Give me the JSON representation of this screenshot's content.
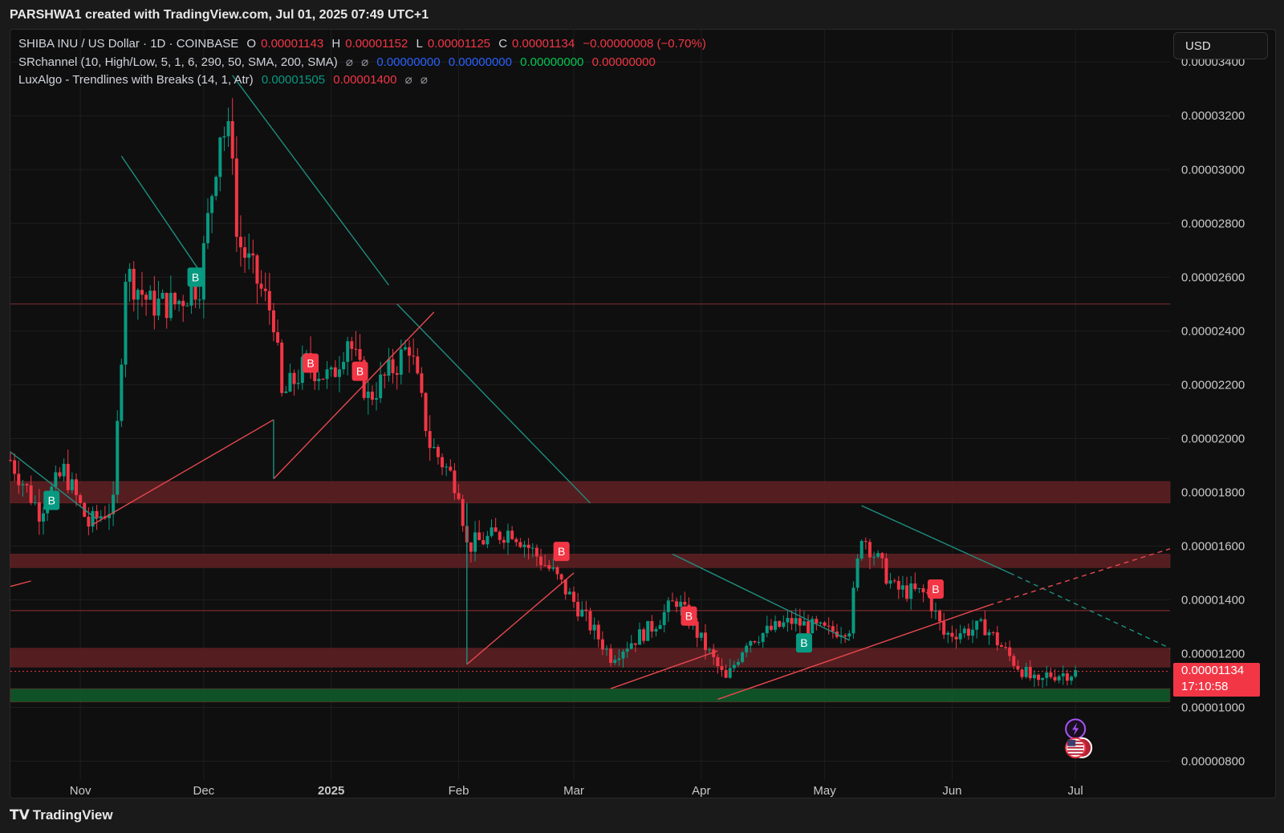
{
  "caption": "PARSHWA1 created with TradingView.com, Jul 01, 2025 07:49 UTC+1",
  "legend": {
    "symbol": "SHIBA INU / US Dollar · 1D · COINBASE",
    "o_label": "O",
    "o_value": "0.00001143",
    "h_label": "H",
    "h_value": "0.00001152",
    "l_label": "L",
    "l_value": "0.00001125",
    "c_label": "C",
    "c_value": "0.00001134",
    "change": "−0.00000008 (−0.70%)",
    "ind1_name": "SRchannel (10, High/Low, 5, 1, 6, 290, 50, SMA, 200, SMA)",
    "ind1_v1": "0.00000000",
    "ind1_v2": "0.00000000",
    "ind1_v3": "0.00000000",
    "ind1_v4": "0.00000000",
    "ind2_name": "LuxAlgo - Trendlines with Breaks (14, 1, Atr)",
    "ind2_v1": "0.00001505",
    "ind2_v2": "0.00001400",
    "hidden_glyph": "⌀"
  },
  "currency": "USD",
  "current_price": "0.00001134",
  "countdown": "17:10:58",
  "footer": "TradingView",
  "colors": {
    "up": "#089981",
    "down": "#f23645",
    "bg": "#0f0f0f"
  },
  "chart_data": {
    "type": "candlestick",
    "y_ticks": [
      "0.00003400",
      "0.00003200",
      "0.00003000",
      "0.00002800",
      "0.00002600",
      "0.00002400",
      "0.00002200",
      "0.00002000",
      "0.00001800",
      "0.00001600",
      "0.00001400",
      "0.00001200",
      "0.00001000",
      "0.00000800"
    ],
    "x_ticks": [
      "Nov",
      "Dec",
      "2025",
      "Feb",
      "Mar",
      "Apr",
      "May",
      "Jun",
      "Jul"
    ],
    "x_tick_dates": [
      "2024-11-01",
      "2024-12-01",
      "2025-01-01",
      "2025-02-01",
      "2025-03-01",
      "2025-04-01",
      "2025-05-01",
      "2025-06-01",
      "2025-07-01"
    ],
    "x_range": [
      "2024-10-15",
      "2025-07-24"
    ],
    "ylim": [
      7.3e-06,
      3.52e-05
    ],
    "grid": true,
    "anchors": [
      [
        "2024-10-15",
        1.92e-05
      ],
      [
        "2024-10-22",
        1.73e-05
      ],
      [
        "2024-10-28",
        1.88e-05
      ],
      [
        "2024-11-03",
        1.68e-05
      ],
      [
        "2024-11-09",
        1.75e-05
      ],
      [
        "2024-11-12",
        2.62e-05
      ],
      [
        "2024-11-18",
        2.5e-05
      ],
      [
        "2024-11-24",
        2.5e-05
      ],
      [
        "2024-11-30",
        2.58e-05
      ],
      [
        "2024-12-05",
        3.15e-05
      ],
      [
        "2024-12-08",
        3.1e-05
      ],
      [
        "2024-12-09",
        2.75e-05
      ],
      [
        "2024-12-18",
        2.45e-05
      ],
      [
        "2024-12-20",
        2.15e-05
      ],
      [
        "2024-12-26",
        2.28e-05
      ],
      [
        "2025-01-01",
        2.22e-05
      ],
      [
        "2025-01-05",
        2.38e-05
      ],
      [
        "2025-01-10",
        2.15e-05
      ],
      [
        "2025-01-17",
        2.28e-05
      ],
      [
        "2025-01-20",
        2.35e-05
      ],
      [
        "2025-01-25",
        1.98e-05
      ],
      [
        "2025-02-01",
        1.82e-05
      ],
      [
        "2025-02-03",
        1.6e-05
      ],
      [
        "2025-02-14",
        1.66e-05
      ],
      [
        "2025-02-24",
        1.5e-05
      ],
      [
        "2025-03-03",
        1.35e-05
      ],
      [
        "2025-03-10",
        1.19e-05
      ],
      [
        "2025-03-20",
        1.3e-05
      ],
      [
        "2025-03-26",
        1.4e-05
      ],
      [
        "2025-04-03",
        1.2e-05
      ],
      [
        "2025-04-07",
        1.1e-05
      ],
      [
        "2025-04-12",
        1.25e-05
      ],
      [
        "2025-04-23",
        1.32e-05
      ],
      [
        "2025-05-02",
        1.28e-05
      ],
      [
        "2025-05-07",
        1.3e-05
      ],
      [
        "2025-05-10",
        1.65e-05
      ],
      [
        "2025-05-18",
        1.44e-05
      ],
      [
        "2025-05-26",
        1.42e-05
      ],
      [
        "2025-05-30",
        1.27e-05
      ],
      [
        "2025-06-09",
        1.3e-05
      ],
      [
        "2025-06-16",
        1.17e-05
      ],
      [
        "2025-06-22",
        1.08e-05
      ],
      [
        "2025-06-24",
        1.12e-05
      ],
      [
        "2025-07-01",
        1.13e-05
      ]
    ],
    "levels": [
      2.5e-05,
      1.36e-05
    ],
    "zones": [
      {
        "from": 1.76e-05,
        "to": 1.84e-05,
        "color": "#5c1f22"
      },
      {
        "from": 1.52e-05,
        "to": 1.57e-05,
        "color": "#5c1f22"
      },
      {
        "from": 1.15e-05,
        "to": 1.22e-05,
        "color": "#5c1f22"
      },
      {
        "from": 1.02e-05,
        "to": 1.07e-05,
        "color": "#0f5a2a"
      }
    ],
    "trendlines": [
      {
        "x1": "2024-10-15",
        "y1": 1.95e-05,
        "x2": "2024-11-05",
        "y2": 1.7e-05,
        "color": "#1d8f80"
      },
      {
        "x1": "2024-11-11",
        "y1": 3.05e-05,
        "x2": "2024-12-01",
        "y2": 2.6e-05,
        "color": "#1d8f80"
      },
      {
        "x1": "2024-12-08",
        "y1": 3.35e-05,
        "x2": "2025-01-15",
        "y2": 2.57e-05,
        "color": "#1d8f80"
      },
      {
        "x1": "2025-01-17",
        "y1": 2.5e-05,
        "x2": "2025-03-05",
        "y2": 1.76e-05,
        "color": "#1d8f80"
      },
      {
        "x1": "2025-03-25",
        "y1": 1.57e-05,
        "x2": "2025-05-07",
        "y2": 1.25e-05,
        "color": "#1d8f80"
      },
      {
        "x1": "2025-05-10",
        "y1": 1.75e-05,
        "x2": "2025-06-15",
        "y2": 1.5e-05,
        "color": "#1d8f80"
      },
      {
        "x1": "2025-06-15",
        "y1": 1.5e-05,
        "x2": "2025-07-24",
        "y2": 1.22e-05,
        "color": "#1d8f80",
        "dashed": true
      },
      {
        "x1": "2024-11-04",
        "y1": 1.68e-05,
        "x2": "2024-12-18",
        "y2": 2.07e-05,
        "color": "#e8484f"
      },
      {
        "x1": "2024-12-18",
        "y1": 1.85e-05,
        "x2": "2025-01-26",
        "y2": 2.47e-05,
        "color": "#e8484f"
      },
      {
        "x1": "2025-02-03",
        "y1": 1.16e-05,
        "x2": "2025-03-01",
        "y2": 1.5e-05,
        "color": "#e8484f"
      },
      {
        "x1": "2025-03-10",
        "y1": 1.07e-05,
        "x2": "2025-04-05",
        "y2": 1.21e-05,
        "color": "#e8484f"
      },
      {
        "x1": "2025-04-05",
        "y1": 1.03e-05,
        "x2": "2025-06-10",
        "y2": 1.38e-05,
        "color": "#e8484f"
      },
      {
        "x1": "2025-06-10",
        "y1": 1.38e-05,
        "x2": "2025-07-24",
        "y2": 1.59e-05,
        "color": "#e8484f",
        "dashed": true
      },
      {
        "x1": "2024-10-15",
        "y1": 1.45e-05,
        "x2": "2024-10-20",
        "y2": 1.47e-05,
        "color": "#e8484f"
      }
    ],
    "drops": [
      {
        "x": "2024-12-18",
        "y1": 2.07e-05,
        "y2": 1.85e-05,
        "color": "#1d8f80"
      },
      {
        "x": "2025-02-03",
        "y1": 1.76e-05,
        "y2": 1.16e-05,
        "color": "#1d8f80"
      }
    ],
    "markers": [
      {
        "label": "B",
        "date": "2024-10-25",
        "y": 1.77e-05,
        "color": "#089981"
      },
      {
        "label": "B",
        "date": "2024-11-29",
        "y": 2.6e-05,
        "color": "#089981"
      },
      {
        "label": "B",
        "date": "2024-12-27",
        "y": 2.28e-05,
        "color": "#f23645"
      },
      {
        "label": "B",
        "date": "2025-01-08",
        "y": 2.25e-05,
        "color": "#f23645"
      },
      {
        "label": "B",
        "date": "2025-02-26",
        "y": 1.58e-05,
        "color": "#f23645"
      },
      {
        "label": "B",
        "date": "2025-03-29",
        "y": 1.34e-05,
        "color": "#f23645"
      },
      {
        "label": "B",
        "date": "2025-04-26",
        "y": 1.24e-05,
        "color": "#089981"
      },
      {
        "label": "B",
        "date": "2025-05-28",
        "y": 1.44e-05,
        "color": "#f23645"
      }
    ]
  }
}
